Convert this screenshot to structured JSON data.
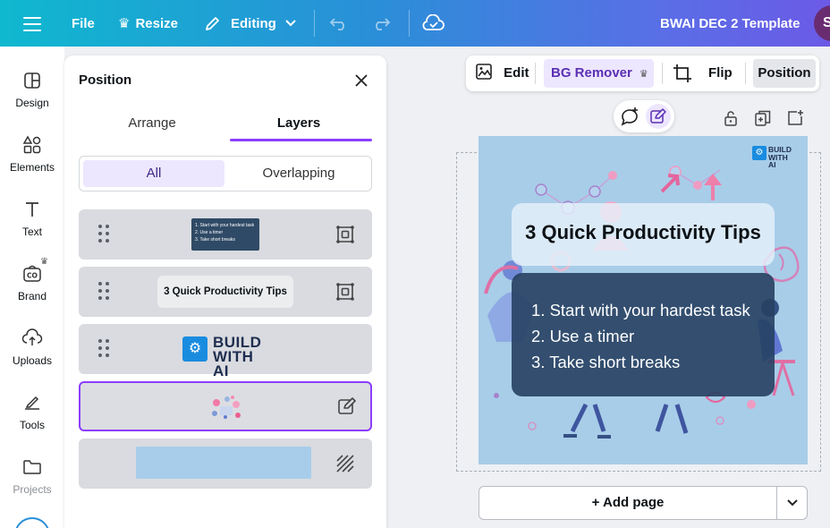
{
  "topbar": {
    "file": "File",
    "resize": "Resize",
    "editing": "Editing",
    "doc_title": "BWAI DEC 2 Template",
    "avatar_initial": "S"
  },
  "rail": {
    "items": [
      {
        "label": "Design",
        "icon": "design-icon"
      },
      {
        "label": "Elements",
        "icon": "elements-icon"
      },
      {
        "label": "Text",
        "icon": "text-icon"
      },
      {
        "label": "Brand",
        "icon": "brand-icon"
      },
      {
        "label": "Uploads",
        "icon": "uploads-icon"
      },
      {
        "label": "Tools",
        "icon": "tools-icon"
      },
      {
        "label": "Projects",
        "icon": "projects-icon"
      }
    ]
  },
  "panel": {
    "title": "Position",
    "tabs": [
      "Arrange",
      "Layers"
    ],
    "filters": [
      "All",
      "Overlapping"
    ],
    "layers": {
      "list_thumb": [
        "1. Start with your hardest task",
        "2. Use a timer",
        "3. Take short breaks"
      ],
      "title_thumb": "3 Quick Productivity Tips",
      "logo_line1": "BUILD",
      "logo_line2": "WITH AI"
    }
  },
  "context_bar": {
    "edit": "Edit",
    "bg_remover": "BG Remover",
    "flip": "Flip",
    "position": "Position"
  },
  "design": {
    "brand_line1": "BUILD",
    "brand_line2": "WITH AI",
    "title": "3 Quick Productivity Tips",
    "tips": [
      "1. Start with your hardest task",
      "2. Use a timer",
      "3. Take short breaks"
    ]
  },
  "add_page": "+ Add page",
  "colors": {
    "accent": "#8b3dff",
    "artboard": "#a8cde8",
    "list_box": "#264062"
  }
}
